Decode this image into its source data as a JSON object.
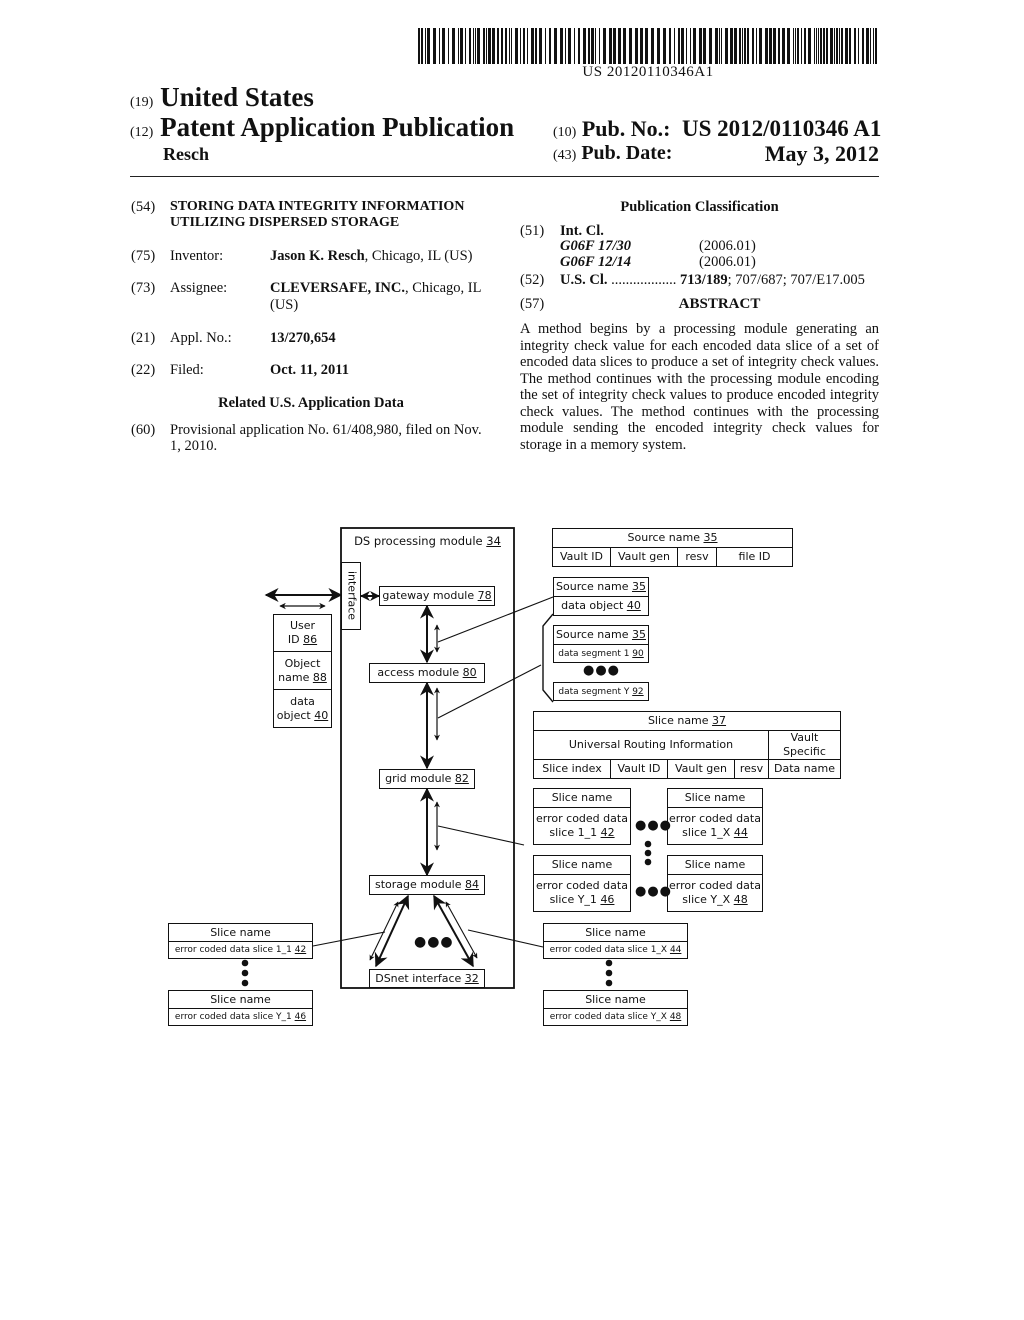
{
  "barcode": {
    "text": "US 20120110346A1"
  },
  "header": {
    "country_code": "(19)",
    "country": "United States",
    "type_code": "(12)",
    "type": "Patent Application Publication",
    "inventor_short": "Resch",
    "pub_no_code": "(10)",
    "pub_no_label": "Pub. No.:",
    "pub_no": "US 2012/0110346 A1",
    "pub_date_code": "(43)",
    "pub_date_label": "Pub. Date:",
    "pub_date": "May 3, 2012"
  },
  "biblio": {
    "title_code": "(54)",
    "title_line1": "STORING DATA INTEGRITY INFORMATION",
    "title_line2": "UTILIZING DISPERSED STORAGE",
    "inventor_code": "(75)",
    "inventor_label": "Inventor:",
    "inventor_name": "Jason K. Resch",
    "inventor_loc": ", Chicago, IL (US)",
    "assignee_code": "(73)",
    "assignee_label": "Assignee:",
    "assignee_name": "CLEVERSAFE, INC.",
    "assignee_loc1": ", Chicago, IL",
    "assignee_loc2": "(US)",
    "appl_code": "(21)",
    "appl_label": "Appl. No.:",
    "appl_no": "13/270,654",
    "filed_code": "(22)",
    "filed_label": "Filed:",
    "filed_date": "Oct. 11, 2011",
    "related_heading": "Related U.S. Application Data",
    "prov_code": "(60)",
    "prov_line1": "Provisional application No. 61/408,980, filed on Nov.",
    "prov_line2": "1, 2010."
  },
  "classification": {
    "heading": "Publication Classification",
    "intcl_code": "(51)",
    "intcl_label": "Int. Cl.",
    "intcl": [
      {
        "class": "G06F 17/30",
        "version": "(2006.01)"
      },
      {
        "class": "G06F 12/14",
        "version": "(2006.01)"
      }
    ],
    "uscl_code": "(52)",
    "uscl_label": "U.S. Cl.",
    "uscl_dots": "..................",
    "uscl_primary": "713/189",
    "uscl_rest": "; 707/687; 707/E17.005"
  },
  "abstract": {
    "code": "(57)",
    "heading": "ABSTRACT",
    "text": "A method begins by a processing module generating an integrity check value for each encoded data slice of a set of encoded data slices to produce a set of integrity check values. The method continues with the processing module encoding the set of integrity check values to produce encoded integrity check values. The method continues with the processing module sending the encoded integrity check values for storage in a memory system."
  },
  "diagram": {
    "ds_module": {
      "label": "DS processing module ",
      "ref": "34"
    },
    "interface": "interface",
    "gateway": {
      "label": "gateway module ",
      "ref": "78"
    },
    "access": {
      "label": "access module ",
      "ref": "80"
    },
    "grid": {
      "label": "grid module ",
      "ref": "82"
    },
    "storage": {
      "label": "storage module ",
      "ref": "84"
    },
    "dsnet": {
      "label": "DSnet interface ",
      "ref": "32"
    },
    "user_block": {
      "user_id": {
        "l1": "User",
        "l2": "ID ",
        "ref": "86"
      },
      "object_name": {
        "l1": "Object",
        "l2": "name ",
        "ref": "88"
      },
      "data_object": {
        "l1": "data",
        "l2": "object ",
        "ref": "40"
      }
    },
    "source_name_table": {
      "title": "Source name ",
      "ref": "35",
      "fields": [
        "Vault ID",
        "Vault gen",
        "resv",
        "file ID"
      ]
    },
    "source_object": {
      "title": "Source name ",
      "ref": "35",
      "body": "data object ",
      "body_ref": "40"
    },
    "segments": {
      "title": "Source name ",
      "ref": "35",
      "seg1": "data segment 1 ",
      "seg1_ref": "90",
      "segY": "data segment Y ",
      "segY_ref": "92",
      "ellipsis": "●●●"
    },
    "slice_name_table": {
      "title": "Slice name ",
      "ref": "37",
      "uri": "Universal Routing Information",
      "vault_specific": "Vault Specific",
      "fields": [
        "Slice index",
        "Vault ID",
        "Vault gen",
        "resv",
        "Data name"
      ]
    },
    "slice_grid": [
      {
        "name": "Slice name",
        "body1": "error coded data",
        "body2": "slice 1_1 ",
        "ref": "42"
      },
      {
        "name": "Slice name",
        "body1": "error coded data",
        "body2": "slice 1_X ",
        "ref": "44"
      },
      {
        "name": "Slice name",
        "body1": "error coded data",
        "body2": "slice Y_1 ",
        "ref": "46"
      },
      {
        "name": "Slice name",
        "body1": "error coded data",
        "body2": "slice Y_X ",
        "ref": "48"
      }
    ],
    "stored_left": [
      {
        "name": "Slice name",
        "body": "error coded data slice 1_1 ",
        "ref": "42"
      },
      {
        "name": "Slice name",
        "body": "error coded data slice Y_1 ",
        "ref": "46"
      }
    ],
    "stored_right": [
      {
        "name": "Slice name",
        "body": "error coded data slice 1_X ",
        "ref": "44"
      },
      {
        "name": "Slice name",
        "body": "error coded data slice Y_X ",
        "ref": "48"
      }
    ],
    "ellipsis_h": "●●●"
  }
}
